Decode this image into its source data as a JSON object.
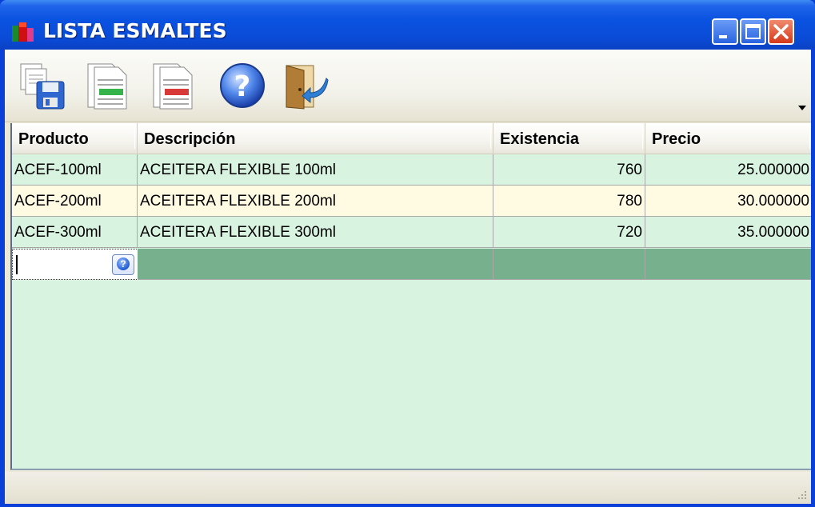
{
  "window": {
    "title": "LISTA ESMALTES",
    "buttons": {
      "minimize": "minimize",
      "maximize": "maximize",
      "close": "close"
    }
  },
  "toolbar": {
    "items": [
      {
        "icon": "save-icon",
        "name": "save"
      },
      {
        "icon": "add-row-icon",
        "name": "add"
      },
      {
        "icon": "delete-row-icon",
        "name": "delete"
      },
      {
        "icon": "help-icon",
        "name": "help"
      },
      {
        "icon": "exit-door-icon",
        "name": "exit"
      }
    ]
  },
  "grid": {
    "columns": [
      "Producto",
      "Descripción",
      "Existencia",
      "Precio"
    ],
    "rows": [
      {
        "producto": "ACEF-100ml",
        "descripcion": "ACEITERA FLEXIBLE 100ml",
        "existencia": "760",
        "precio": "25.000000"
      },
      {
        "producto": "ACEF-200ml",
        "descripcion": "ACEITERA FLEXIBLE 200ml",
        "existencia": "780",
        "precio": "30.000000"
      },
      {
        "producto": "ACEF-300ml",
        "descripcion": "ACEITERA FLEXIBLE 300ml",
        "existencia": "720",
        "precio": "35.000000"
      }
    ],
    "new_row": {
      "producto": "",
      "lookup_icon": "help-lookup-icon"
    }
  },
  "colors": {
    "titlebar": "#0a52e0",
    "row_green": "#d8f4e0",
    "row_yellow": "#fffbe3",
    "new_row": "#76b08c"
  }
}
